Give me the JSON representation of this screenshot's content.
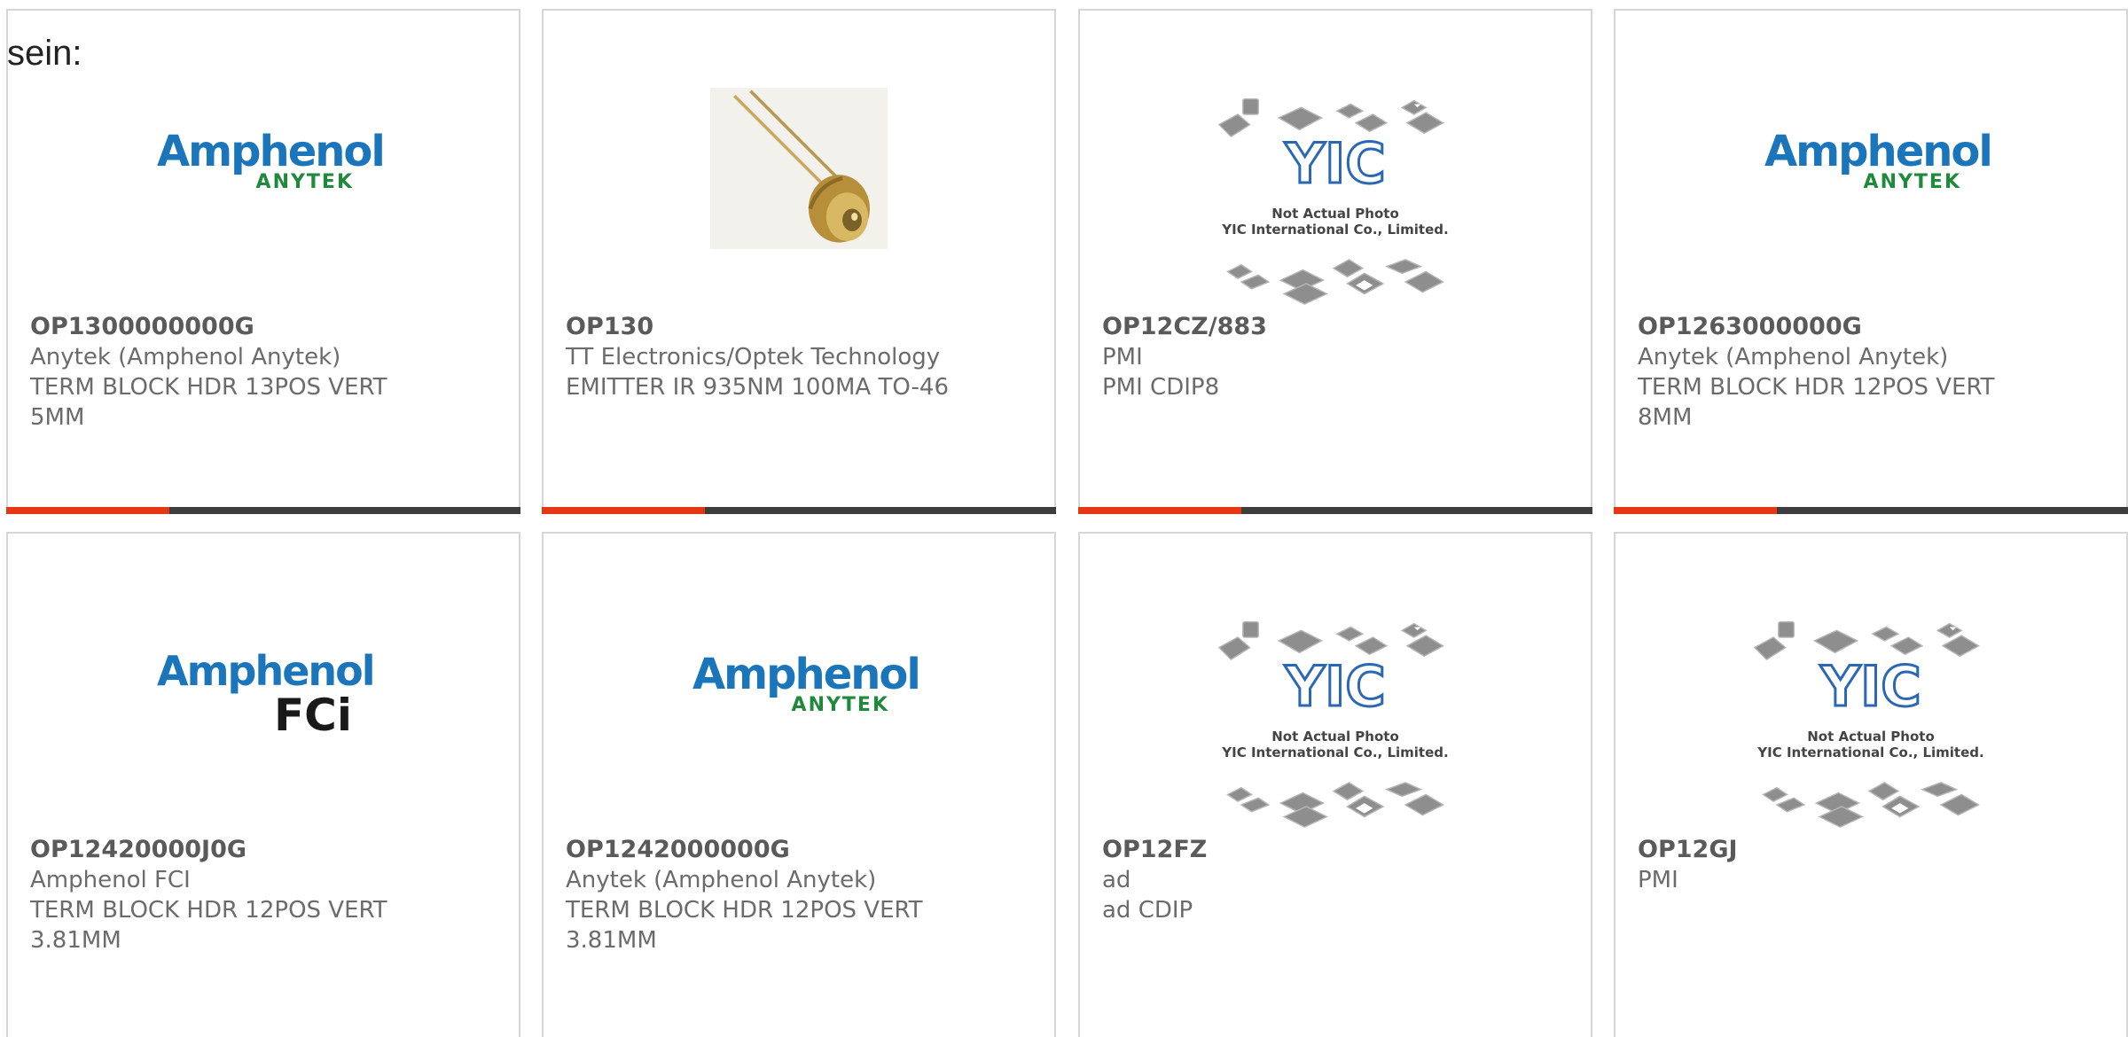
{
  "intro_text": "sein:",
  "brand_colors": {
    "accent": "#e43713",
    "bar_dark": "#3d3d3d",
    "amphenol_blue": "#1b75bb",
    "anytek_green": "#1f8a3c"
  },
  "logo_text": {
    "amphenol": "Amphenol",
    "anytek": "ANYTEK",
    "fci": "FCi",
    "yic_mark": "YIC",
    "yic_line1": "Not Actual Photo",
    "yic_line2": "YIC International Co., Limited."
  },
  "products": [
    {
      "part_number": "OP1300000000G",
      "manufacturer": "Anytek (Amphenol Anytek)",
      "description_line1": "TERM BLOCK HDR 13POS VERT",
      "description_line2": "5MM",
      "image": "amphenol-anytek-logo"
    },
    {
      "part_number": "OP130",
      "manufacturer": "TT Electronics/Optek Technology",
      "description_line1": "EMITTER IR 935NM 100MA TO-46",
      "description_line2": "",
      "image": "to46-emitter-photo"
    },
    {
      "part_number": "OP12CZ/883",
      "manufacturer": "PMI",
      "description_line1": "PMI CDIP8",
      "description_line2": "",
      "image": "yic-placeholder"
    },
    {
      "part_number": "OP1263000000G",
      "manufacturer": "Anytek (Amphenol Anytek)",
      "description_line1": "TERM BLOCK HDR 12POS VERT",
      "description_line2": "8MM",
      "image": "amphenol-anytek-logo"
    },
    {
      "part_number": "OP12420000J0G",
      "manufacturer": "Amphenol FCI",
      "description_line1": "TERM BLOCK HDR 12POS VERT",
      "description_line2": "3.81MM",
      "image": "amphenol-fci-logo"
    },
    {
      "part_number": "OP1242000000G",
      "manufacturer": "Anytek (Amphenol Anytek)",
      "description_line1": "TERM BLOCK HDR 12POS VERT",
      "description_line2": "3.81MM",
      "image": "amphenol-anytek-logo"
    },
    {
      "part_number": "OP12FZ",
      "manufacturer": "ad",
      "description_line1": "ad CDIP",
      "description_line2": "",
      "image": "yic-placeholder"
    },
    {
      "part_number": "OP12GJ",
      "manufacturer": "PMI",
      "description_line1": "",
      "description_line2": "",
      "image": "yic-placeholder"
    }
  ]
}
